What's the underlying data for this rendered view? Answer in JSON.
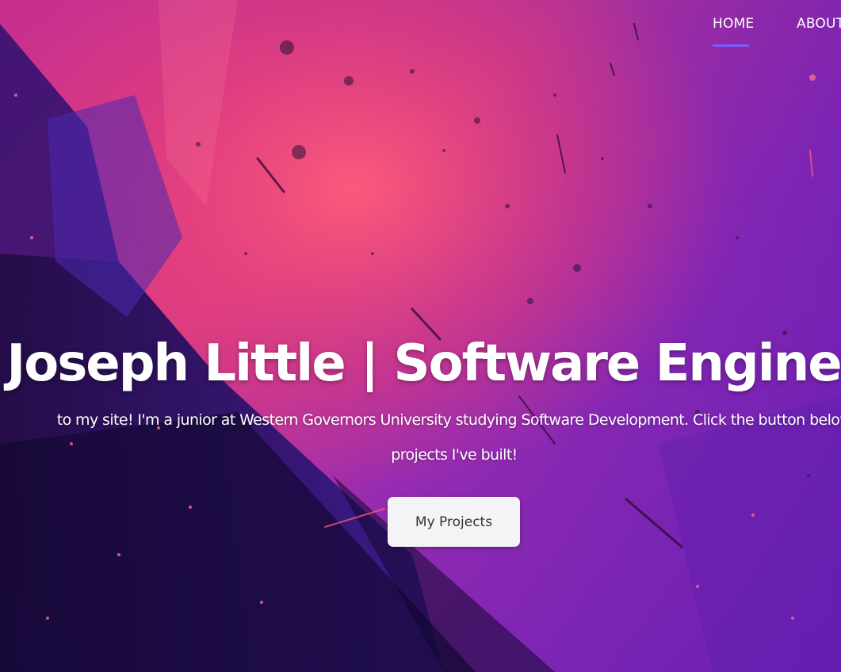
{
  "nav": {
    "items": [
      {
        "label": "HOME",
        "active": true
      },
      {
        "label": "ABOUT",
        "active": false
      }
    ]
  },
  "hero": {
    "title": "Joseph Little | Software Engineer",
    "description_line1": "to my site! I'm a junior at Western Governors University studying Software Development. Click the button below",
    "description_line2": "projects I've built!",
    "button_label": "My Projects"
  },
  "colors": {
    "nav_underline": "#7b5cff",
    "button_bg": "#f4f4f6",
    "button_text": "#333333",
    "text": "#ffffff",
    "bg_pink": "#ee3f74",
    "bg_purple": "#8a2bbd",
    "bg_dark": "#1f0b4d"
  }
}
